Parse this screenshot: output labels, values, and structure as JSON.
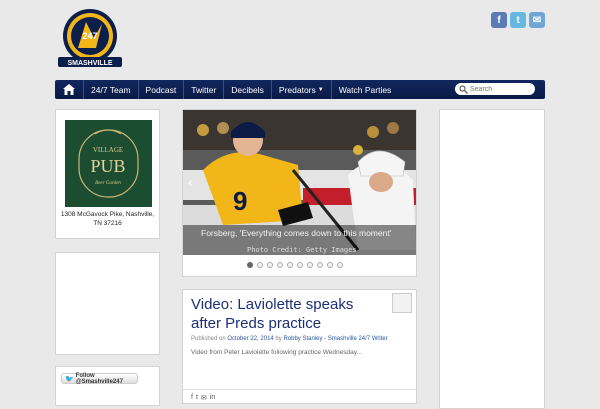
{
  "logo": {
    "text": "SMASHVILLE",
    "number": "247"
  },
  "social": [
    {
      "icon": "facebook-icon",
      "glyph": "f",
      "color": "#5b7bb7"
    },
    {
      "icon": "twitter-icon",
      "glyph": "t",
      "color": "#66b7e2"
    },
    {
      "icon": "email-icon",
      "glyph": "✉",
      "color": "#6fa6d4"
    }
  ],
  "nav": {
    "items": [
      "24/7 Team",
      "Podcast",
      "Twitter",
      "Decibels",
      "Predators",
      "Watch Parties"
    ],
    "search_placeholder": "Search"
  },
  "ad": {
    "sign_top": "VILLAGE",
    "sign_main": "PUB",
    "sign_bottom": "Beer Garden",
    "address": "1308 McGavock Pike, Nashville, TN 37216"
  },
  "follow": {
    "label": "Follow @Smashville247"
  },
  "slider": {
    "caption": "Forsberg, 'Everything comes down to this moment'",
    "credit": "Photo Credit: Getty Images",
    "jersey_number": "9",
    "dot_count": 10,
    "active_dot": 0
  },
  "post": {
    "title": "Video: Laviolette speaks after Preds practice",
    "meta_prefix": "Published on",
    "date": "October 22, 2014",
    "by": "by",
    "author": "Robby Stanley - Smashville 24/7 Writer",
    "excerpt": "Video from Peter Laviolette following practice Wednesday..."
  },
  "colors": {
    "nav": "#10275e",
    "accent": "#1c2e78",
    "gold": "#f2b619"
  }
}
